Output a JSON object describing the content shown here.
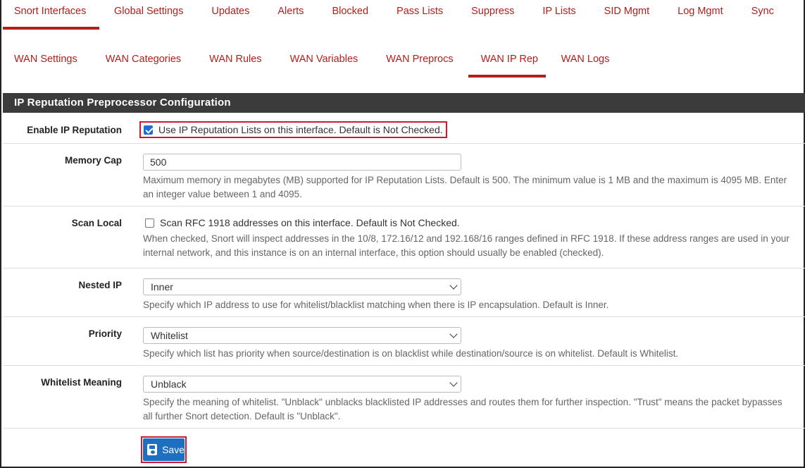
{
  "top_tabs": [
    {
      "label": "Snort Interfaces",
      "active": true
    },
    {
      "label": "Global Settings",
      "active": false
    },
    {
      "label": "Updates",
      "active": false
    },
    {
      "label": "Alerts",
      "active": false
    },
    {
      "label": "Blocked",
      "active": false
    },
    {
      "label": "Pass Lists",
      "active": false
    },
    {
      "label": "Suppress",
      "active": false
    },
    {
      "label": "IP Lists",
      "active": false
    },
    {
      "label": "SID Mgmt",
      "active": false
    },
    {
      "label": "Log Mgmt",
      "active": false
    },
    {
      "label": "Sync",
      "active": false
    }
  ],
  "sub_tabs": [
    {
      "label": "WAN Settings",
      "active": false
    },
    {
      "label": "WAN Categories",
      "active": false
    },
    {
      "label": "WAN Rules",
      "active": false
    },
    {
      "label": "WAN Variables",
      "active": false
    },
    {
      "label": "WAN Preprocs",
      "active": false
    },
    {
      "label": "WAN IP Rep",
      "active": true
    },
    {
      "label": "WAN Logs",
      "active": false
    }
  ],
  "section_title": "IP Reputation Preprocessor Configuration",
  "enable_ip_rep": {
    "label": "Enable IP Reputation",
    "checked": true,
    "text": "Use IP Reputation Lists on this interface. Default is Not Checked."
  },
  "memory_cap": {
    "label": "Memory Cap",
    "value": "500",
    "help": "Maximum memory in megabytes (MB) supported for IP Reputation Lists. Default is 500. The minimum value is 1 MB and the maximum is 4095 MB. Enter an integer value between 1 and 4095."
  },
  "scan_local": {
    "label": "Scan Local",
    "checked": false,
    "text": "Scan RFC 1918 addresses on this interface. Default is Not Checked.",
    "help": "When checked, Snort will inspect addresses in the 10/8, 172.16/12 and 192.168/16 ranges defined in RFC 1918. If these address ranges are used in your internal network, and this instance is on an internal interface, this option should usually be enabled (checked)."
  },
  "nested_ip": {
    "label": "Nested IP",
    "value": "Inner",
    "help": "Specify which IP address to use for whitelist/blacklist matching when there is IP encapsulation. Default is Inner."
  },
  "priority": {
    "label": "Priority",
    "value": "Whitelist",
    "help": "Specify which list has priority when source/destination is on blacklist while destination/source is on whitelist. Default is Whitelist."
  },
  "whitelist_meaning": {
    "label": "Whitelist Meaning",
    "value": "Unblack",
    "help": "Specify the meaning of whitelist. \"Unblack\" unblacks blacklisted IP addresses and routes them for further inspection. \"Trust\" means the packet bypasses all further Snort detection. Default is \"Unblack\"."
  },
  "save_label": "Save",
  "colors": {
    "accent": "#b31e1e",
    "button": "#1e6fbf",
    "highlight": "#d0192e",
    "header_bg": "#3b3b3b"
  }
}
